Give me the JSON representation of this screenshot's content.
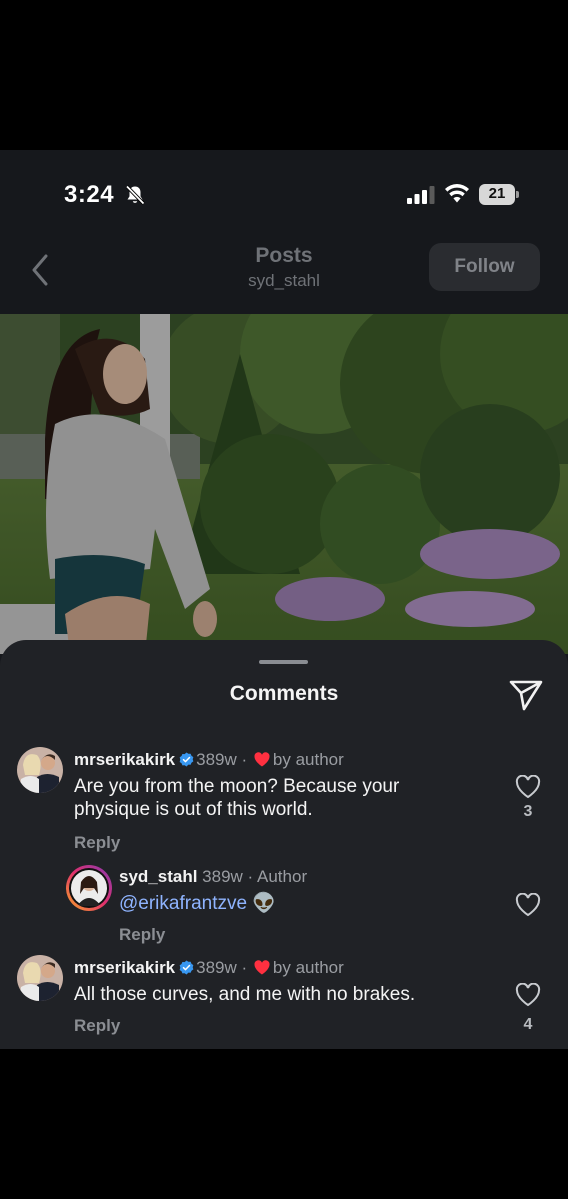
{
  "status_bar": {
    "time": "3:24",
    "battery": "21",
    "icons": [
      "bell-slash-icon",
      "signal-icon",
      "wifi-icon",
      "battery-icon"
    ]
  },
  "nav": {
    "title": "Posts",
    "subtitle": "syd_stahl",
    "follow_label": "Follow",
    "back_icon": "chevron-left-icon"
  },
  "sheet": {
    "title": "Comments",
    "share_icon": "send-icon"
  },
  "comments": [
    {
      "username": "mrserikakirk",
      "verified": true,
      "age": "389w",
      "separator": "·",
      "liked_by_author": "by author",
      "text": "Are you from the moon? Because your physique is out of this world.",
      "reply_label": "Reply",
      "likes": "3"
    },
    {
      "username": "syd_stahl",
      "age": "389w",
      "separator": "·",
      "badge": "Author",
      "mention": "@erikafrantzve",
      "emoji": "👽",
      "reply_label": "Reply"
    },
    {
      "username": "mrserikakirk",
      "verified": true,
      "age": "389w",
      "separator": "·",
      "liked_by_author": "by author",
      "text": "All those curves, and me with no brakes.",
      "reply_label": "Reply",
      "likes": "4"
    }
  ],
  "colors": {
    "background": "#16181c",
    "sheet": "#202226",
    "verified": "#3897f0",
    "heart": "#ff3040",
    "mention": "#8fb4ff"
  }
}
